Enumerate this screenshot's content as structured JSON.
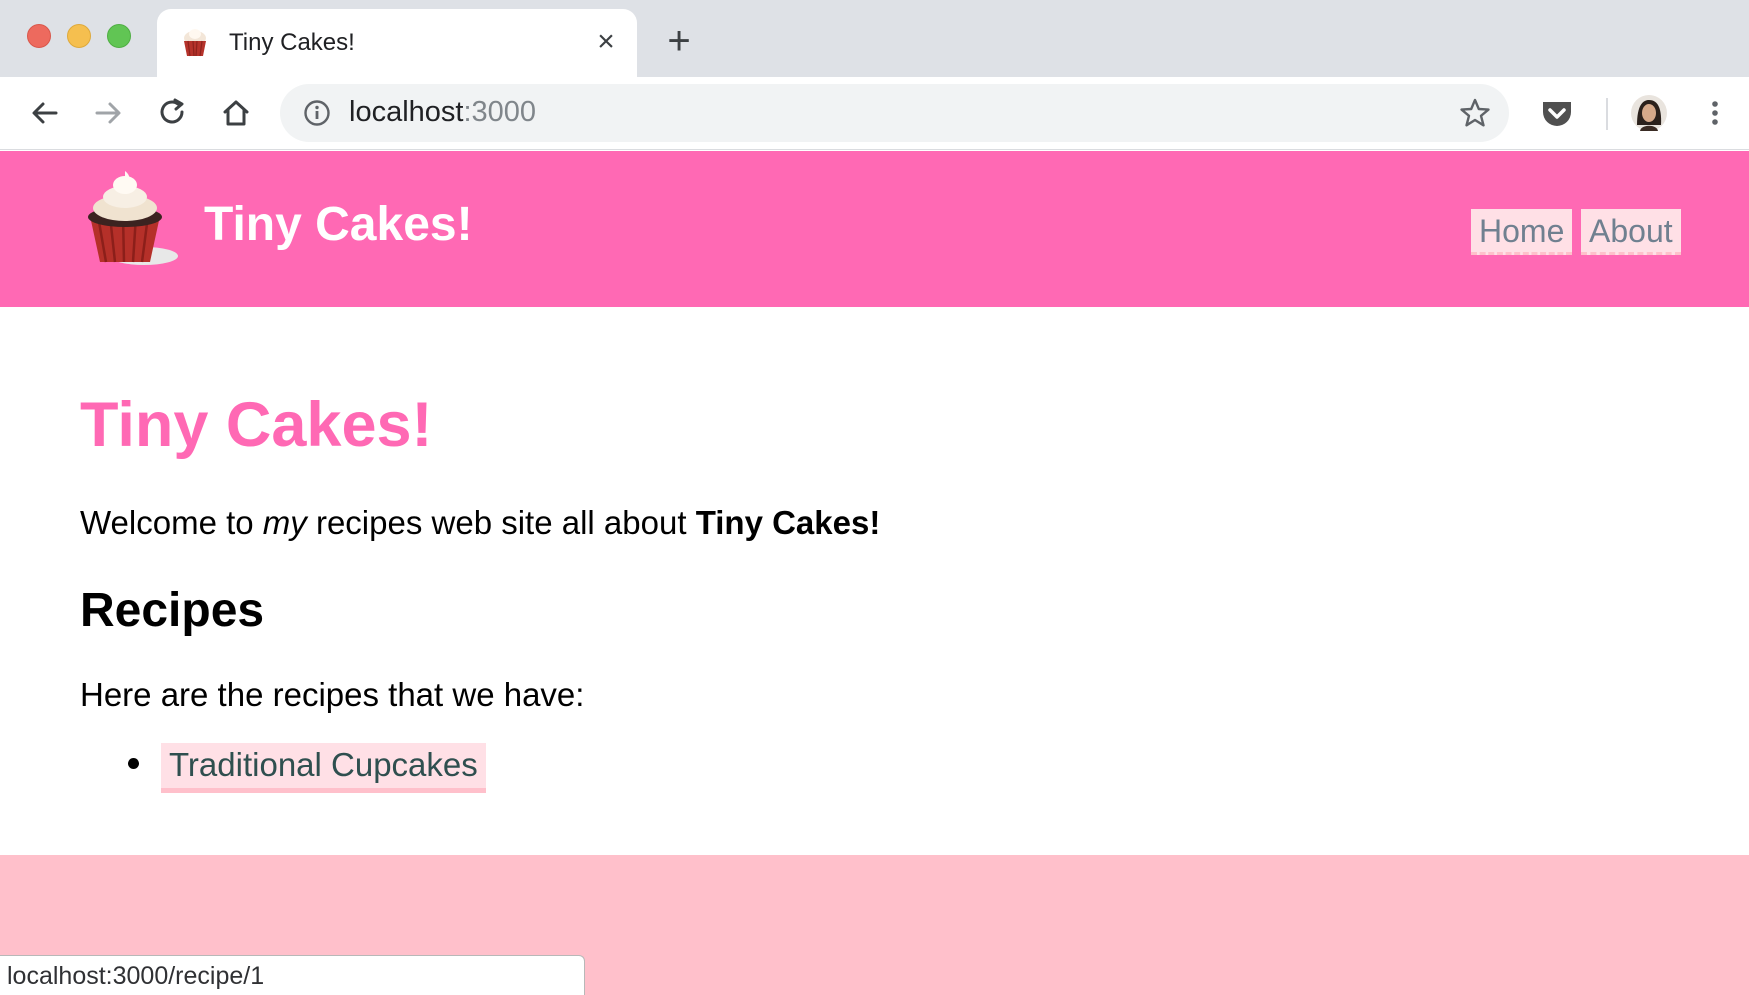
{
  "browser": {
    "tab": {
      "title": "Tiny Cakes!",
      "favicon": "cupcake-icon"
    },
    "address": {
      "host": "localhost",
      "port": ":3000"
    },
    "status_url": "localhost:3000/recipe/1",
    "colors": {
      "tabstrip": "#dee1e6",
      "omnibox": "#f1f3f4"
    }
  },
  "site": {
    "header": {
      "logo": "cupcake-logo",
      "title": "Tiny Cakes!",
      "nav": {
        "home": "Home",
        "about": "About"
      }
    },
    "main": {
      "title": "Tiny Cakes!",
      "intro": {
        "part1": "Welcome to ",
        "emphasis": "my",
        "part2": " recipes web site all about ",
        "strong": "Tiny Cakes!"
      },
      "recipes_heading": "Recipes",
      "recipes_text": "Here are the recipes that we have:",
      "recipes": [
        {
          "label": "Traditional Cupcakes"
        }
      ]
    },
    "colors": {
      "header": "#ff69b4",
      "footer": "#ffc0cb",
      "link_bg": "#ffe0e6",
      "title": "#ff69b4"
    }
  }
}
